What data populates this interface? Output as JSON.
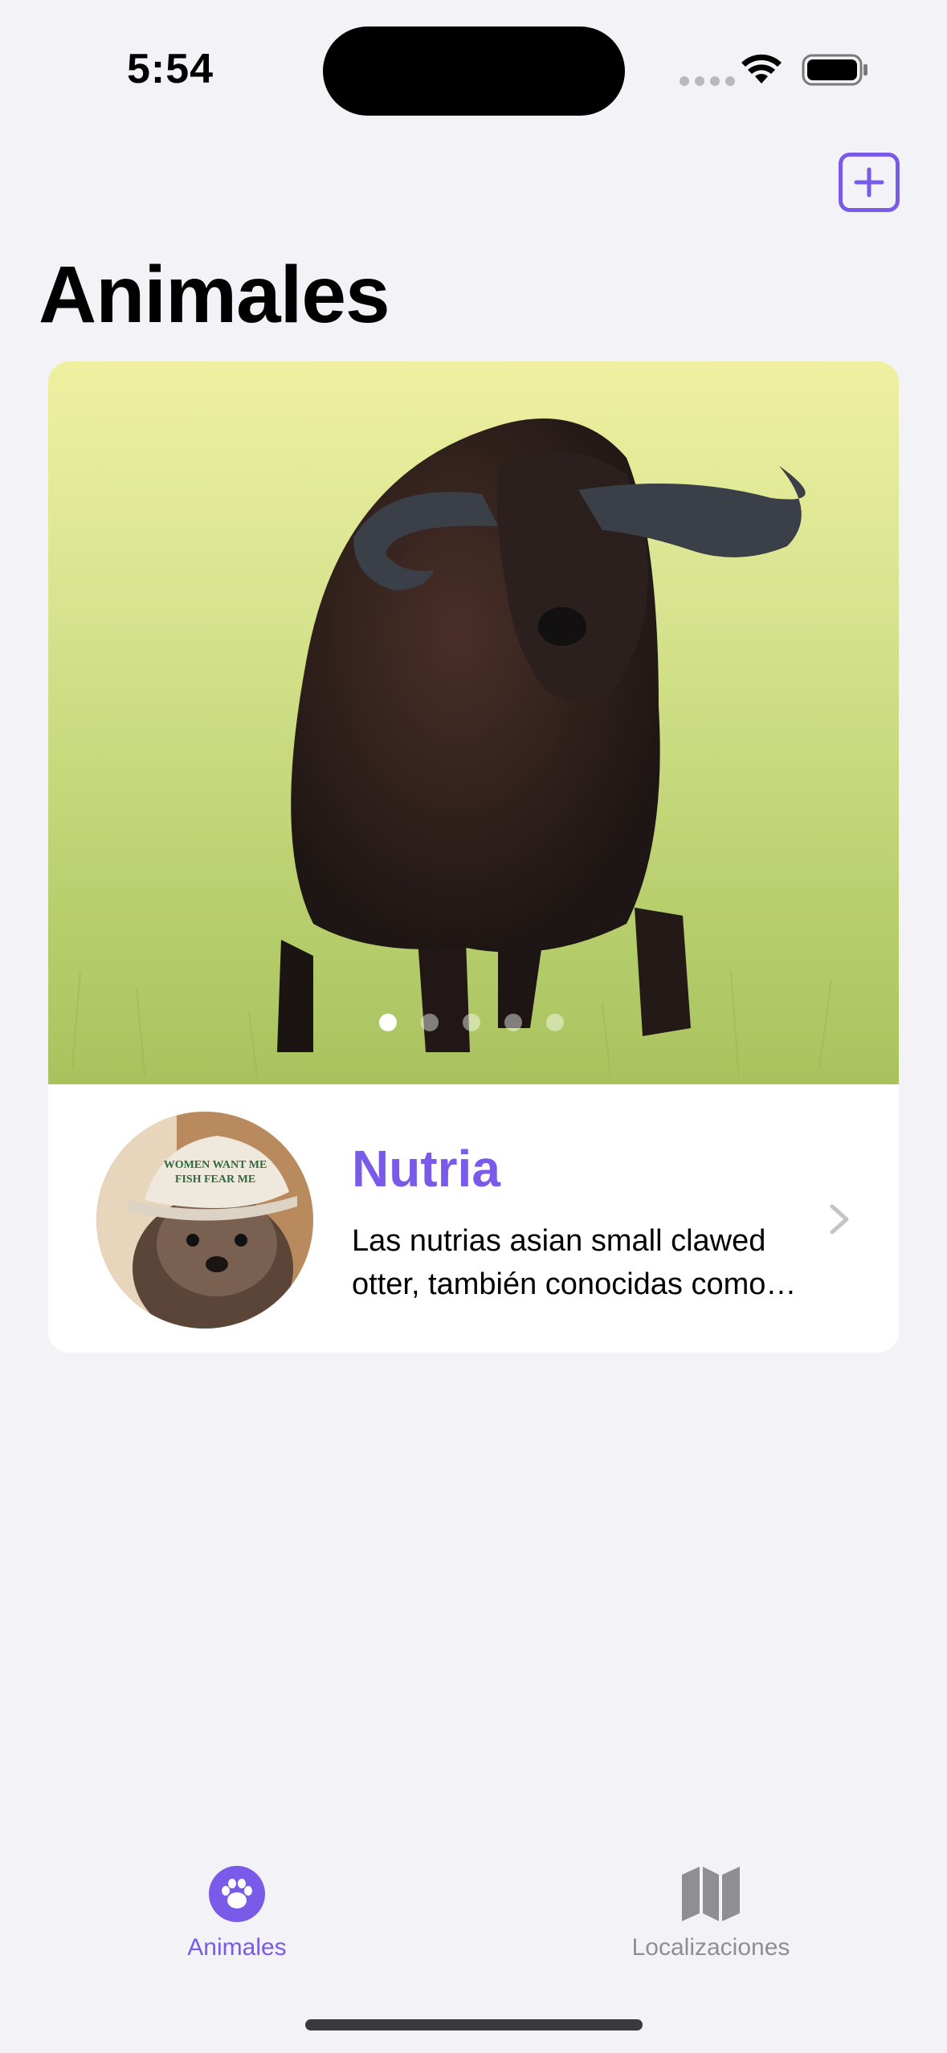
{
  "status_bar": {
    "time": "5:54"
  },
  "nav": {
    "title": "Animales",
    "add_icon": "plus-square-icon"
  },
  "card": {
    "carousel": {
      "page_count": 5,
      "current_page": 1
    },
    "title": "Nutria",
    "description": "Las nutrias asian small clawed otter, también conocidas como nutrias enanas asiáticas",
    "avatar_cap_text": "WOMEN WANT ME FISH FEAR ME"
  },
  "tab_bar": {
    "items": [
      {
        "label": "Animales",
        "icon": "paw-icon",
        "selected": true
      },
      {
        "label": "Localizaciones",
        "icon": "map-icon",
        "selected": false
      }
    ]
  },
  "colors": {
    "accent": "#7a5ae8",
    "background": "#f2f2f7",
    "inactive": "#8e8e93"
  }
}
